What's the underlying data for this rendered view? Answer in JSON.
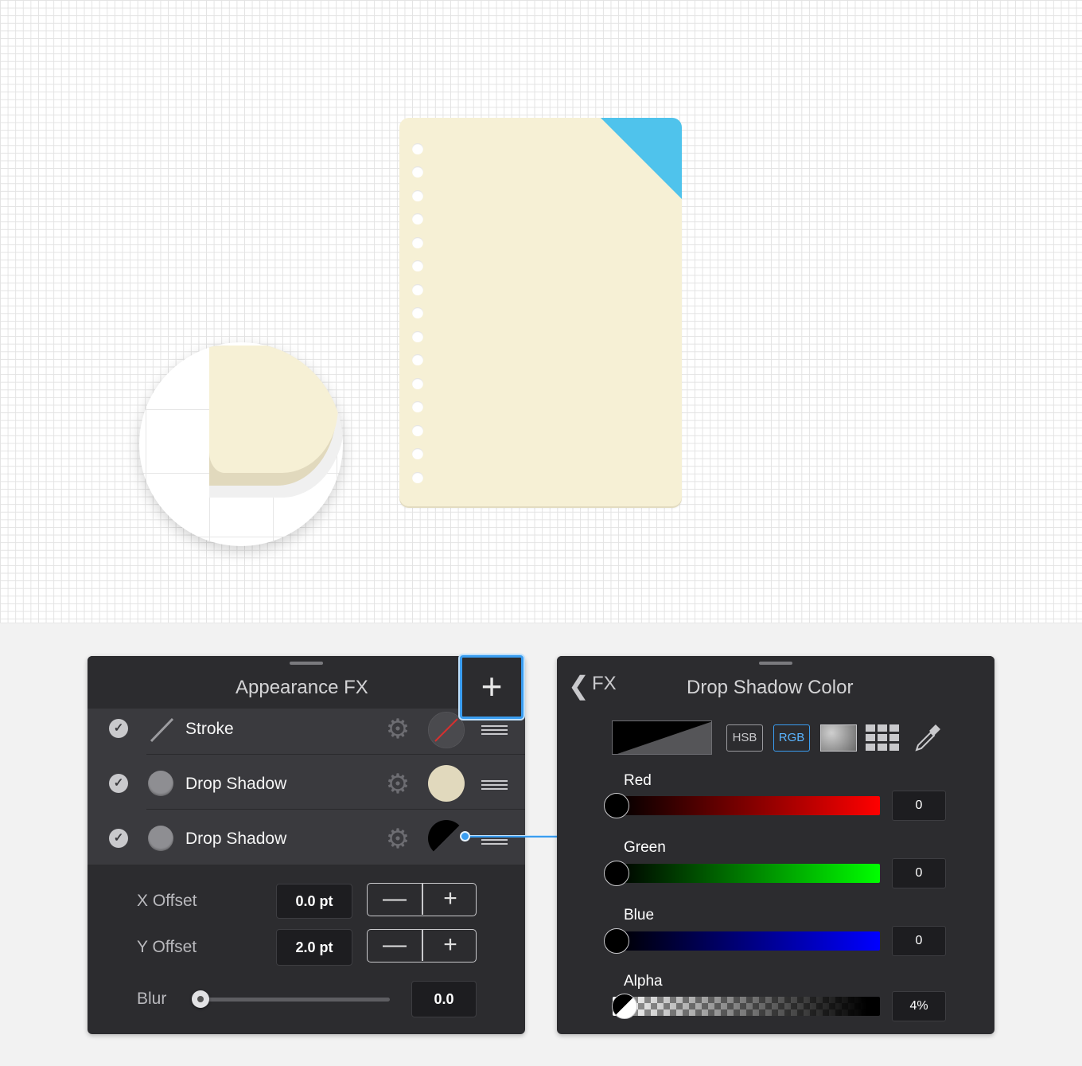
{
  "fx_panel": {
    "title": "Appearance FX",
    "add_label": "+",
    "rows": [
      {
        "label": "Stroke",
        "icon": "stroke-line-icon",
        "enabled": true,
        "swatch": "none"
      },
      {
        "label": "Drop Shadow",
        "icon": "circle-icon",
        "enabled": true,
        "swatch": "#e1d9bd"
      },
      {
        "label": "Drop Shadow",
        "icon": "circle-icon",
        "enabled": true,
        "swatch": "black-transparent"
      }
    ],
    "x_offset_label": "X Offset",
    "x_offset_value": "0.0 pt",
    "y_offset_label": "Y Offset",
    "y_offset_value": "2.0 pt",
    "blur_label": "Blur",
    "blur_value": "0.0",
    "minus_glyph": "—",
    "plus_glyph": "+"
  },
  "color_panel": {
    "back_label": "FX",
    "title": "Drop Shadow Color",
    "modes": [
      "HSB",
      "RGB"
    ],
    "active_mode": "RGB",
    "sliders": [
      {
        "label": "Red",
        "value": "0",
        "color": "#ff0000"
      },
      {
        "label": "Green",
        "value": "0",
        "color": "#00ff00"
      },
      {
        "label": "Blue",
        "value": "0",
        "color": "#0000ff"
      },
      {
        "label": "Alpha",
        "value": "4%"
      }
    ]
  },
  "colors": {
    "paper": "#f6f0d5",
    "corner_tab": "#4fc3ec",
    "accent": "#3a9df0",
    "panel_bg": "#2c2c2f"
  }
}
